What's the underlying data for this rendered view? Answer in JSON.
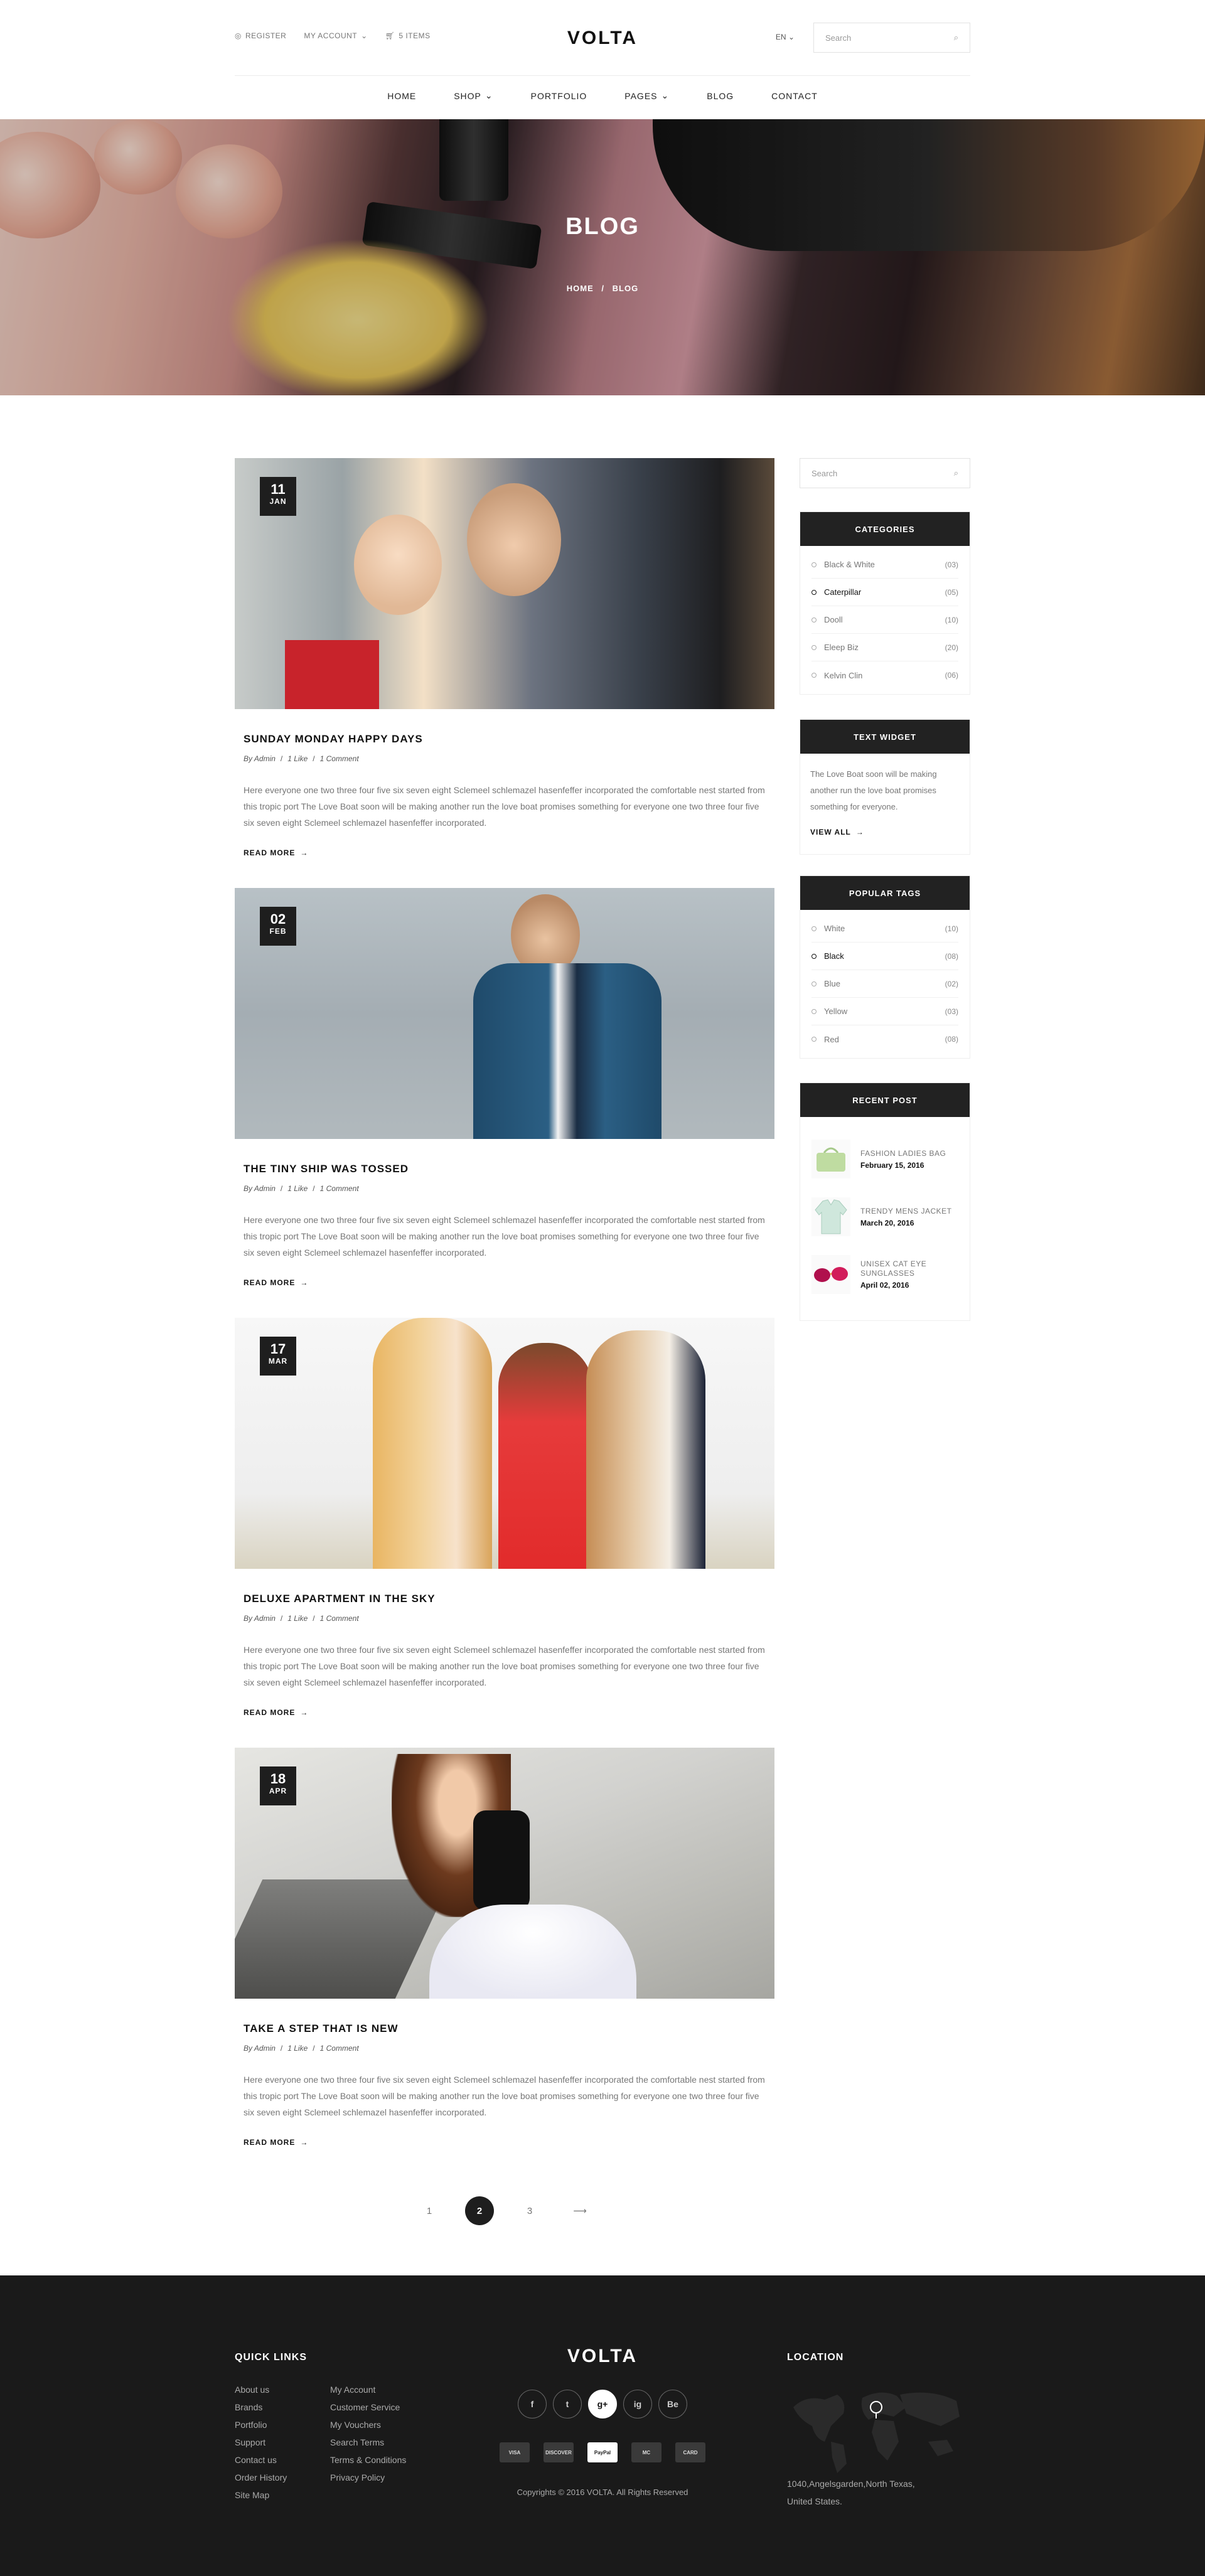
{
  "header": {
    "register": "REGISTER",
    "my_account": "MY ACCOUNT",
    "cart": "5 ITEMS",
    "logo": "VOLTA",
    "lang": "EN",
    "search_placeholder": "Search"
  },
  "nav": [
    "HOME",
    "SHOP",
    "PORTFOLIO",
    "PAGES",
    "BLOG",
    "CONTACT"
  ],
  "banner": {
    "title": "BLOG",
    "crumb_home": "HOME",
    "crumb_sep": "/",
    "crumb_current": "BLOG"
  },
  "posts": [
    {
      "day": "11",
      "month": "JAN",
      "title": "SUNDAY MONDAY HAPPY DAYS",
      "author": "By Admin",
      "likes": "1 Like",
      "comments": "1 Comment",
      "excerpt": "Here everyone one two three four five six seven eight Sclemeel schlemazel hasenfeffer incorporated  the comfortable nest started from this tropic port The Love Boat soon will be making another run the love boat promises something for everyone one two three four five six seven eight Sclemeel schlemazel hasenfeffer incorporated.",
      "readmore": "READ MORE"
    },
    {
      "day": "02",
      "month": "FEB",
      "title": "THE TINY SHIP WAS TOSSED",
      "author": "By Admin",
      "likes": "1 Like",
      "comments": "1 Comment",
      "excerpt": "Here everyone one two three four five six seven eight Sclemeel schlemazel hasenfeffer incorporated  the comfortable nest started from this tropic port The Love Boat soon will be making another run the love boat promises something for everyone one two three four five six seven eight Sclemeel schlemazel hasenfeffer incorporated.",
      "readmore": "READ MORE"
    },
    {
      "day": "17",
      "month": "MAR",
      "title": "DELUXE APARTMENT IN THE SKY",
      "author": "By Admin",
      "likes": "1 Like",
      "comments": "1 Comment",
      "excerpt": "Here everyone one two three four five six seven eight Sclemeel schlemazel hasenfeffer incorporated  the comfortable nest started from this tropic port The Love Boat soon will be making another run the love boat promises something for everyone one two three four five six seven eight Sclemeel schlemazel hasenfeffer incorporated.",
      "readmore": "READ MORE"
    },
    {
      "day": "18",
      "month": "APR",
      "title": "TAKE A STEP THAT IS NEW",
      "author": "By Admin",
      "likes": "1 Like",
      "comments": "1 Comment",
      "excerpt": "Here everyone one two three four five six seven eight Sclemeel schlemazel hasenfeffer incorporated  the comfortable nest started from this tropic port The Love Boat soon will be making another run the love boat promises something for everyone one two three four five six seven eight Sclemeel schlemazel hasenfeffer incorporated.",
      "readmore": "READ MORE"
    }
  ],
  "sidebar": {
    "search_placeholder": "Search",
    "categories": {
      "title": "CATEGORIES",
      "items": [
        {
          "label": "Black & White",
          "count": "(03)"
        },
        {
          "label": "Caterpillar",
          "count": "(05)"
        },
        {
          "label": "Dooll",
          "count": "(10)"
        },
        {
          "label": "Eleep Biz",
          "count": "(20)"
        },
        {
          "label": "Kelvin Clin",
          "count": "(06)"
        }
      ]
    },
    "text_widget": {
      "title": "TEXT WIDGET",
      "body": "The Love Boat soon will be making another run the love boat promises something for everyone.",
      "link": "VIEW ALL"
    },
    "tags": {
      "title": "POPULAR TAGS",
      "items": [
        {
          "label": "White",
          "count": "(10)"
        },
        {
          "label": "Black",
          "count": "(08)"
        },
        {
          "label": "Blue",
          "count": "(02)"
        },
        {
          "label": "Yellow",
          "count": "(03)"
        },
        {
          "label": "Red",
          "count": "(08)"
        }
      ]
    },
    "recent": {
      "title": "RECENT POST",
      "items": [
        {
          "name": "FASHION LADIES BAG",
          "date": "February 15, 2016",
          "icon": "bag-icon"
        },
        {
          "name": "TRENDY MENS JACKET",
          "date": "March 20, 2016",
          "icon": "jacket-icon"
        },
        {
          "name": "UNISEX CAT EYE SUNGLASSES",
          "date": "April 02, 2016",
          "icon": "sunglasses-icon"
        }
      ]
    }
  },
  "pagination": [
    "1",
    "2",
    "3"
  ],
  "footer": {
    "quick_links_title": "QUICK LINKS",
    "col1": [
      "About us",
      "Brands",
      "Portfolio",
      "Support",
      "Contact us",
      "Order History",
      "Site Map"
    ],
    "col2": [
      "My Account",
      "Customer Service",
      "My Vouchers",
      "Search Terms",
      "Terms & Conditions",
      "Privacy Policy"
    ],
    "logo": "VOLTA",
    "socials": [
      "f",
      "t",
      "g+",
      "ig",
      "Be"
    ],
    "payments": [
      "VISA",
      "DISCOVER",
      "PayPal",
      "MC",
      "CARD"
    ],
    "copyright": "Copyrights © 2016 VOLTA. All Rights Reserved",
    "location_title": "LOCATION",
    "address": "1040,Angelsgarden,North Texas, United States."
  },
  "colors": {
    "dark": "#222222",
    "footer": "#1a1a1a",
    "accent": "#1e1e1e"
  }
}
